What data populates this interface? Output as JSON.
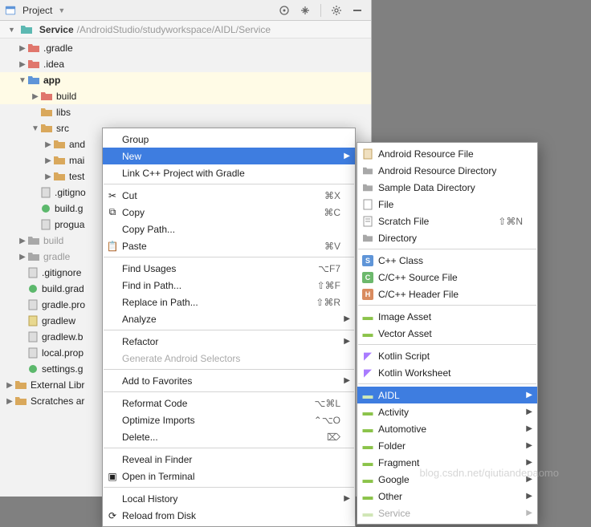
{
  "topbar": {
    "title": "Project"
  },
  "breadcrumb": {
    "root": "Service",
    "path": "/AndroidStudio/studyworkspace/AIDL/Service"
  },
  "tree": {
    "gradle": ".gradle",
    "idea": ".idea",
    "app": "app",
    "build": "build",
    "libs": "libs",
    "src": "src",
    "and": "and",
    "mai": "mai",
    "test": "test",
    "gitign": ".gitigno",
    "buildg": "build.g",
    "progua": "progua",
    "build2": "build",
    "gradle2": "gradle",
    "gitign2": ".gitignore",
    "buildgrad": "build.grad",
    "gradleprop": "gradle.pro",
    "gradlew": "gradlew",
    "gradlewb": "gradlew.b",
    "localprop": "local.prop",
    "settingsg": "settings.g",
    "extlib": "External Libr",
    "scratch": "Scratches ar"
  },
  "ctx": {
    "group": "Group",
    "new": "New",
    "linkcpp": "Link C++ Project with Gradle",
    "cut": "Cut",
    "cut_sc": "⌘X",
    "copy": "Copy",
    "copy_sc": "⌘C",
    "copypath": "Copy Path...",
    "paste": "Paste",
    "paste_sc": "⌘V",
    "findusages": "Find Usages",
    "findusages_sc": "⌥F7",
    "findinpath": "Find in Path...",
    "findinpath_sc": "⇧⌘F",
    "replaceinpath": "Replace in Path...",
    "replaceinpath_sc": "⇧⌘R",
    "analyze": "Analyze",
    "refactor": "Refactor",
    "genandroid": "Generate Android Selectors",
    "addfav": "Add to Favorites",
    "reformat": "Reformat Code",
    "reformat_sc": "⌥⌘L",
    "optimize": "Optimize Imports",
    "optimize_sc": "⌃⌥O",
    "delete": "Delete...",
    "delete_sc": "⌦",
    "reveal": "Reveal in Finder",
    "openterm": "Open in Terminal",
    "localhist": "Local History",
    "reload": "Reload from Disk"
  },
  "sub": {
    "resfile": "Android Resource File",
    "resdir": "Android Resource Directory",
    "sampledir": "Sample Data Directory",
    "file": "File",
    "scratch": "Scratch File",
    "scratch_sc": "⇧⌘N",
    "directory": "Directory",
    "cppclass": "C++ Class",
    "cppsource": "C/C++ Source File",
    "cppheader": "C/C++ Header File",
    "imgasset": "Image Asset",
    "vecasset": "Vector Asset",
    "kotscript": "Kotlin Script",
    "kotwork": "Kotlin Worksheet",
    "aidl": "AIDL",
    "activity": "Activity",
    "automotive": "Automotive",
    "folder": "Folder",
    "fragment": "Fragment",
    "google": "Google",
    "other": "Other",
    "service": "Service"
  },
  "watermark": "blog.csdn.net/qiutiandepaomo"
}
